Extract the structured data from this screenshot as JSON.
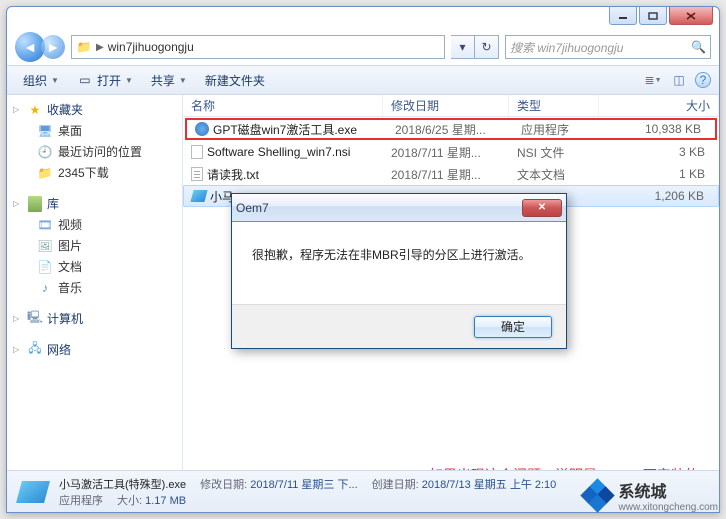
{
  "address": {
    "folder": "win7jihuogongju"
  },
  "search": {
    "placeholder": "搜索 win7jihuogongju"
  },
  "toolbar": {
    "organize": "组织",
    "open": "打开",
    "share": "共享",
    "newFolder": "新建文件夹"
  },
  "sidebar": {
    "fav": {
      "header": "收藏夹",
      "desktop": "桌面",
      "recent": "最近访问的位置",
      "dl": "2345下载"
    },
    "lib": {
      "header": "库",
      "video": "视频",
      "pic": "图片",
      "doc": "文档",
      "music": "音乐"
    },
    "computer": "计算机",
    "network": "网络"
  },
  "columns": {
    "name": "名称",
    "date": "修改日期",
    "type": "类型",
    "size": "大小"
  },
  "files": [
    {
      "name": "GPT磁盘win7激活工具.exe",
      "date": "2018/6/25 星期...",
      "type": "应用程序",
      "size": "10,938 KB",
      "hl": true,
      "icon": "exe"
    },
    {
      "name": "Software Shelling_win7.nsi",
      "date": "2018/7/11 星期...",
      "type": "NSI 文件",
      "size": "3 KB",
      "icon": "nsi"
    },
    {
      "name": "请读我.txt",
      "date": "2018/7/11 星期...",
      "type": "文本文档",
      "size": "1 KB",
      "icon": "txt"
    },
    {
      "name": "小马",
      "date": "",
      "type": "",
      "size": "1,206 KB",
      "sel": true,
      "icon": "exe2"
    }
  ],
  "dialog": {
    "title": "Oem7",
    "body": "很抱歉，程序无法在非MBR引导的分区上进行激活。",
    "ok": "确定"
  },
  "annotation": "如果出现这个问题，说明是uefi gpt下安装的，此时运行gpt激活工具",
  "details": {
    "name": "小马激活工具(特殊型).exe",
    "type": "应用程序",
    "modLabel": "修改日期:",
    "modVal": "2018/7/11 星期三 下...",
    "sizeLabel": "大小:",
    "sizeVal": "1.17 MB",
    "createLabel": "创建日期:",
    "createVal": "2018/7/13 星期五 上午 2:10"
  },
  "watermark": {
    "brand": "系统城",
    "url": "www.xitongcheng.com"
  }
}
